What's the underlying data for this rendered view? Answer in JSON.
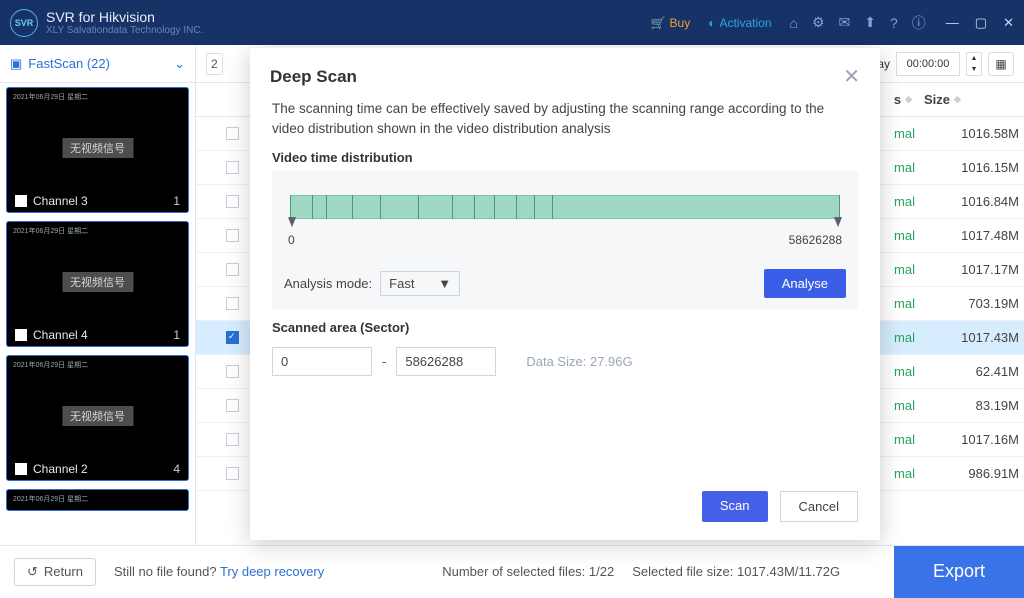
{
  "titlebar": {
    "app_name": "SVR for Hikvision",
    "app_subtitle": "XLY Salvationdata Technology INC.",
    "buy_label": "Buy",
    "activation_label": "Activation"
  },
  "sidebar": {
    "tab_label": "FastScan (22)",
    "thumbs": [
      {
        "label": "Channel 3",
        "index": "1",
        "center": "无视频信号",
        "meta": "2021年06月29日  星期二"
      },
      {
        "label": "Channel 4",
        "index": "1",
        "center": "无视频信号",
        "meta": "2021年06月29日  星期二"
      },
      {
        "label": "Channel 2",
        "index": "4",
        "center": "无视频信号",
        "meta": "2021年06月29日  星期二"
      },
      {
        "label": "",
        "index": "",
        "center": "",
        "meta": "2021年06月29日  星期二"
      }
    ]
  },
  "toolbar": {
    "play_suffix": "ay",
    "time_value": "00:00:00"
  },
  "table": {
    "headers": {
      "status": "s",
      "size": "Size"
    },
    "status_suffix": "mal",
    "rows": [
      {
        "size": "1016.58M",
        "selected": false
      },
      {
        "size": "1016.15M",
        "selected": false
      },
      {
        "size": "1016.84M",
        "selected": false
      },
      {
        "size": "1017.48M",
        "selected": false
      },
      {
        "size": "1017.17M",
        "selected": false
      },
      {
        "size": "703.19M",
        "selected": false
      },
      {
        "size": "1017.43M",
        "selected": true
      },
      {
        "size": "62.41M",
        "selected": false
      },
      {
        "size": "83.19M",
        "selected": false
      },
      {
        "size": "1017.16M",
        "selected": false
      },
      {
        "size": "986.91M",
        "selected": false
      }
    ]
  },
  "footer": {
    "return_label": "Return",
    "no_file_text": "Still no file found? ",
    "try_deep": "Try deep recovery",
    "selected_count": "Number of selected files: 1/22",
    "selected_size": "Selected file size: 1017.43M/11.72G",
    "export_label": "Export"
  },
  "modal": {
    "title": "Deep Scan",
    "description": "The scanning time can be effectively saved by adjusting the scanning range according to the video distribution shown in the video distribution analysis",
    "dist_label": "Video time distribution",
    "range_start": "0",
    "range_end": "58626288",
    "analysis_mode_label": "Analysis mode:",
    "analysis_mode_value": "Fast",
    "analyse_btn": "Analyse",
    "scanned_label": "Scanned area (Sector)",
    "scan_from": "0",
    "scan_dash": "-",
    "scan_to": "58626288",
    "data_size": "Data Size: 27.96G",
    "scan_btn": "Scan",
    "cancel_btn": "Cancel"
  }
}
